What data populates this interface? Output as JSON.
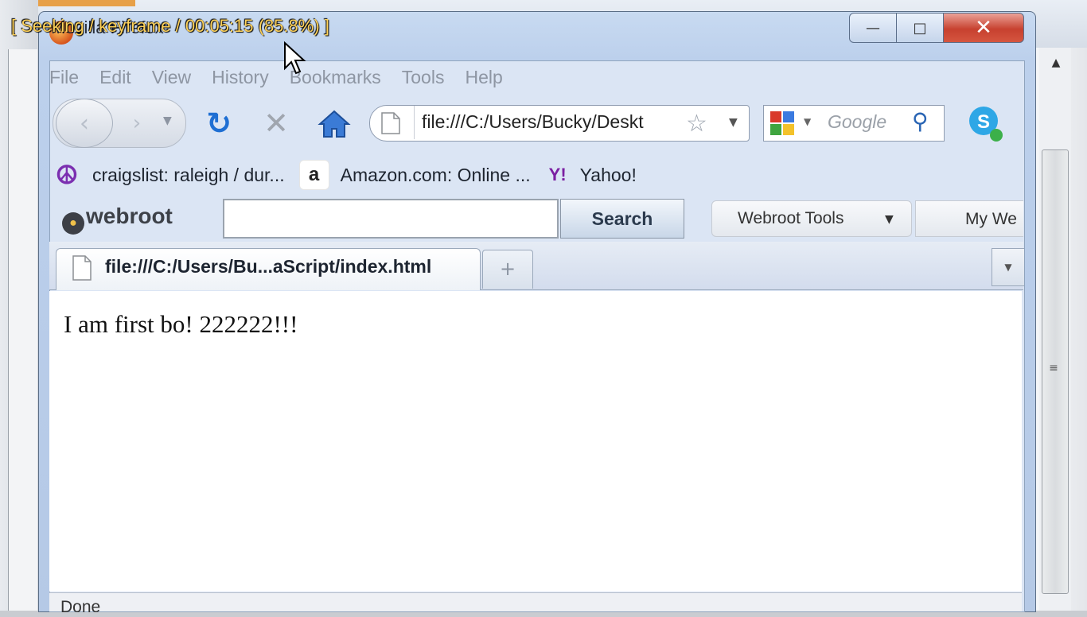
{
  "overlay": {
    "text": "[ Seeking / keyframe / 00:05:15 (85.8%) ]"
  },
  "window": {
    "title": "Mozilla Firefox",
    "controls": {
      "minimize": "—",
      "maximize": "□",
      "close": "✕"
    }
  },
  "menu": [
    {
      "label": "File"
    },
    {
      "label": "Edit"
    },
    {
      "label": "View"
    },
    {
      "label": "History"
    },
    {
      "label": "Bookmarks"
    },
    {
      "label": "Tools"
    },
    {
      "label": "Help"
    }
  ],
  "navigation": {
    "back_icon": "back-arrow-icon",
    "forward_icon": "forward-arrow-icon",
    "reload_icon": "reload-icon",
    "stop_icon": "stop-icon",
    "home_icon": "home-icon",
    "url": "file:///C:/Users/Bucky/Deskt",
    "search_placeholder": "Google"
  },
  "bookmarks": [
    {
      "label": "craigslist: raleigh / dur...",
      "icon": "peace-icon"
    },
    {
      "label": "Amazon.com: Online ...",
      "icon": "amazon-icon"
    },
    {
      "label": "Yahoo!",
      "icon": "yahoo-icon"
    }
  ],
  "webroot": {
    "logo": "webroot",
    "search_button": "Search",
    "tools_label": "Webroot Tools",
    "myweb_label": "My We"
  },
  "tabs": {
    "active_title": "file:///C:/Users/Bu...aScript/index.html",
    "new_tab_glyph": "+"
  },
  "page": {
    "body_text": "I am first bo! 222222!!!"
  },
  "status": {
    "text": "Done"
  },
  "colors": {
    "accent_blue": "#1f6fd3",
    "close_red": "#c7412f",
    "overlay_yellow": "#ffd25a"
  }
}
